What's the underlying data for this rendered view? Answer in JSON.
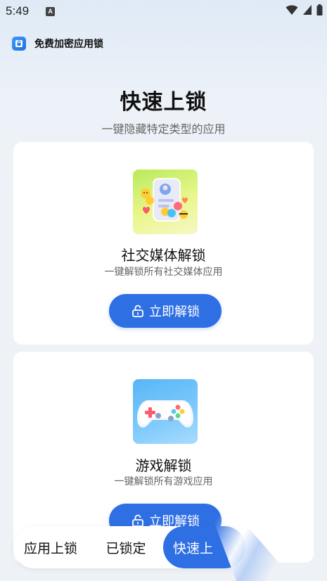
{
  "status": {
    "time": "5:49",
    "notif_icon": "a-icon",
    "right_icons": [
      "wifi-icon",
      "signal-icon",
      "battery-icon"
    ]
  },
  "app": {
    "title": "免费加密应用锁",
    "logo_icon": "lock-shield-icon"
  },
  "hero": {
    "title": "快速上锁",
    "subtitle": "一键隐藏特定类型的应用"
  },
  "cards": [
    {
      "title": "社交媒体解锁",
      "description": "一键解锁所有社交媒体应用",
      "button_label": "立即解锁",
      "icon": "social-media-icon"
    },
    {
      "title": "游戏解锁",
      "description": "一键解锁所有游戏应用",
      "button_label": "立即解锁",
      "icon": "gamepad-icon"
    }
  ],
  "bottom_nav": {
    "items": [
      {
        "label": "应用上锁",
        "active": false
      },
      {
        "label": "已锁定",
        "active": false
      },
      {
        "label": "快速上",
        "active": true
      }
    ]
  },
  "colors": {
    "accent": "#2f6fe4",
    "background": "#eef1f6",
    "card": "#ffffff"
  }
}
